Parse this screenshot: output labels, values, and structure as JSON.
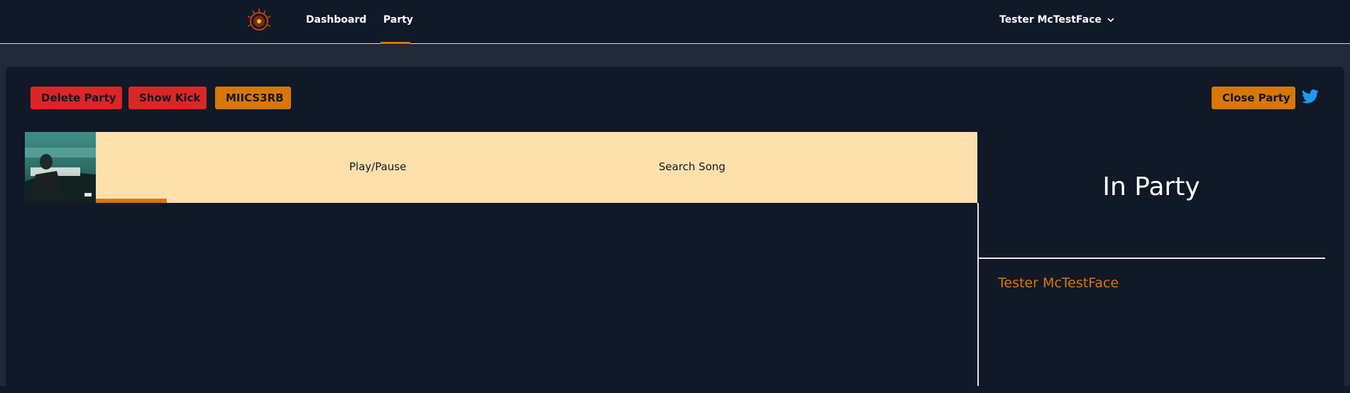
{
  "nav": {
    "logo_icon": "party-logo-icon",
    "links": [
      {
        "label": "Dashboard"
      },
      {
        "label": "Party"
      }
    ],
    "active": "Party",
    "user": {
      "name": "Tester McTestFace",
      "icon": "chevron-down-icon"
    }
  },
  "toolbar": {
    "delete_label": "Delete Party",
    "kick_label": "Show Kick",
    "code_label": "MIICS3RB",
    "close_label": "Close Party",
    "share_icon": "twitter-icon"
  },
  "player": {
    "album_art": "album-art-icon",
    "play_pause_label": "Play/Pause",
    "search_label": "Search Song"
  },
  "party": {
    "title": "In Party",
    "members": [
      "Tester McTestFace"
    ]
  },
  "colors": {
    "background": "#111827",
    "band": "#1f2937",
    "accent_orange": "#d97706",
    "danger_red": "#dc2626",
    "player_bg": "#fde0ac",
    "twitter_blue": "#1d9bf0"
  }
}
